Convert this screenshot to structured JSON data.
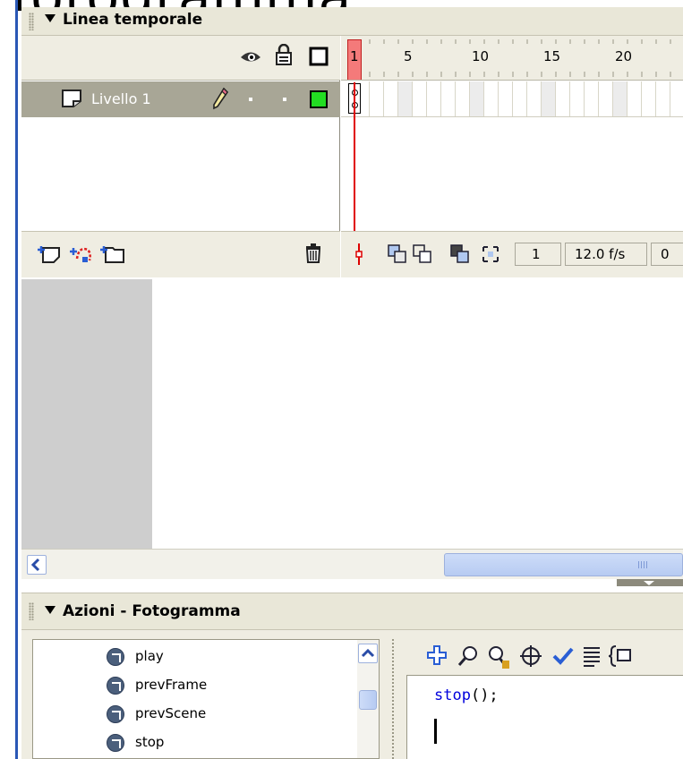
{
  "top_caption": "fotogramma",
  "timeline": {
    "title": "Linea temporale",
    "layer": {
      "name": "Livello 1"
    },
    "ruler_labels": [
      "1",
      "5",
      "10",
      "15",
      "20"
    ],
    "status": {
      "current_frame": "1",
      "frame_rate": "12.0 f/s",
      "elapsed": "0"
    }
  },
  "actions": {
    "title": "Azioni - Fotogramma",
    "items": [
      {
        "label": "play"
      },
      {
        "label": "prevFrame"
      },
      {
        "label": "prevScene"
      },
      {
        "label": "stop"
      }
    ],
    "code": {
      "line1_keyword": "stop",
      "line1_rest": "();"
    }
  },
  "colors": {
    "panel_header": "#e9e7d8",
    "layer_selected": "#a8a696",
    "playhead": "#e00000",
    "pasteboard": "#cecece",
    "code_keyword": "#0000dd",
    "outline_green": "#22dd22"
  },
  "icons": [
    "eye-icon",
    "lock-icon",
    "outline-icon",
    "layer-icon",
    "pencil-icon",
    "insert-layer-icon",
    "add-motion-guide-icon",
    "insert-folder-icon",
    "trash-icon",
    "center-frame-icon",
    "onion-skin-icon",
    "onion-skin-outline-icon",
    "edit-multiple-frames-icon",
    "modify-onion-markers-icon",
    "add-item-icon",
    "find-icon",
    "find-replace-icon",
    "target-path-icon",
    "check-syntax-icon",
    "auto-format-icon",
    "code-hint-icon",
    "action-icon",
    "scroll-left-icon",
    "scroll-up-icon"
  ]
}
